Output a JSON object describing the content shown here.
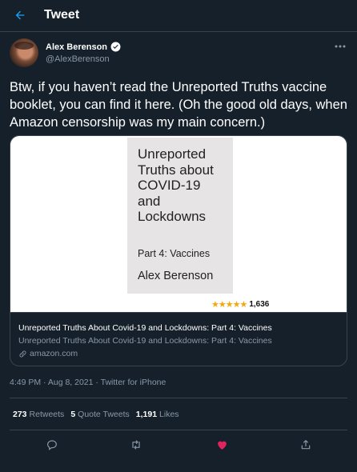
{
  "header": {
    "title": "Tweet",
    "back_icon": "arrow-left-icon"
  },
  "author": {
    "name": "Alex Berenson",
    "handle": "@AlexBerenson",
    "verified": true,
    "more_icon": "ellipsis-icon"
  },
  "tweet": {
    "text": "Btw, if you haven’t read the Unreported Truths vaccine booklet, you can find it here. (Oh the good old days, when Amazon censorship was my main concern.)"
  },
  "card": {
    "book": {
      "title": "Unreported\nTruths about\nCOVID-19\nand\nLockdowns",
      "part": "Part 4: Vaccines",
      "author": "Alex Berenson"
    },
    "rating_stars": "★★★★★",
    "rating_count": "1,636",
    "title": "Unreported Truths About Covid-19 and Lockdowns: Part 4: Vaccines",
    "description": "Unreported Truths About Covid-19 and Lockdowns: Part 4: Vaccines",
    "domain": "amazon.com"
  },
  "meta": {
    "timestamp": "4:49 PM · Aug 8, 2021 · Twitter for iPhone"
  },
  "stats": {
    "retweets": {
      "count": "273",
      "label": "Retweets"
    },
    "quotes": {
      "count": "5",
      "label": "Quote Tweets"
    },
    "likes": {
      "count": "1,191",
      "label": "Likes"
    }
  },
  "colors": {
    "background": "#15202b",
    "accent": "#1da1f2",
    "like": "#e0245e",
    "muted": "#8899a6",
    "border": "#38444d"
  }
}
